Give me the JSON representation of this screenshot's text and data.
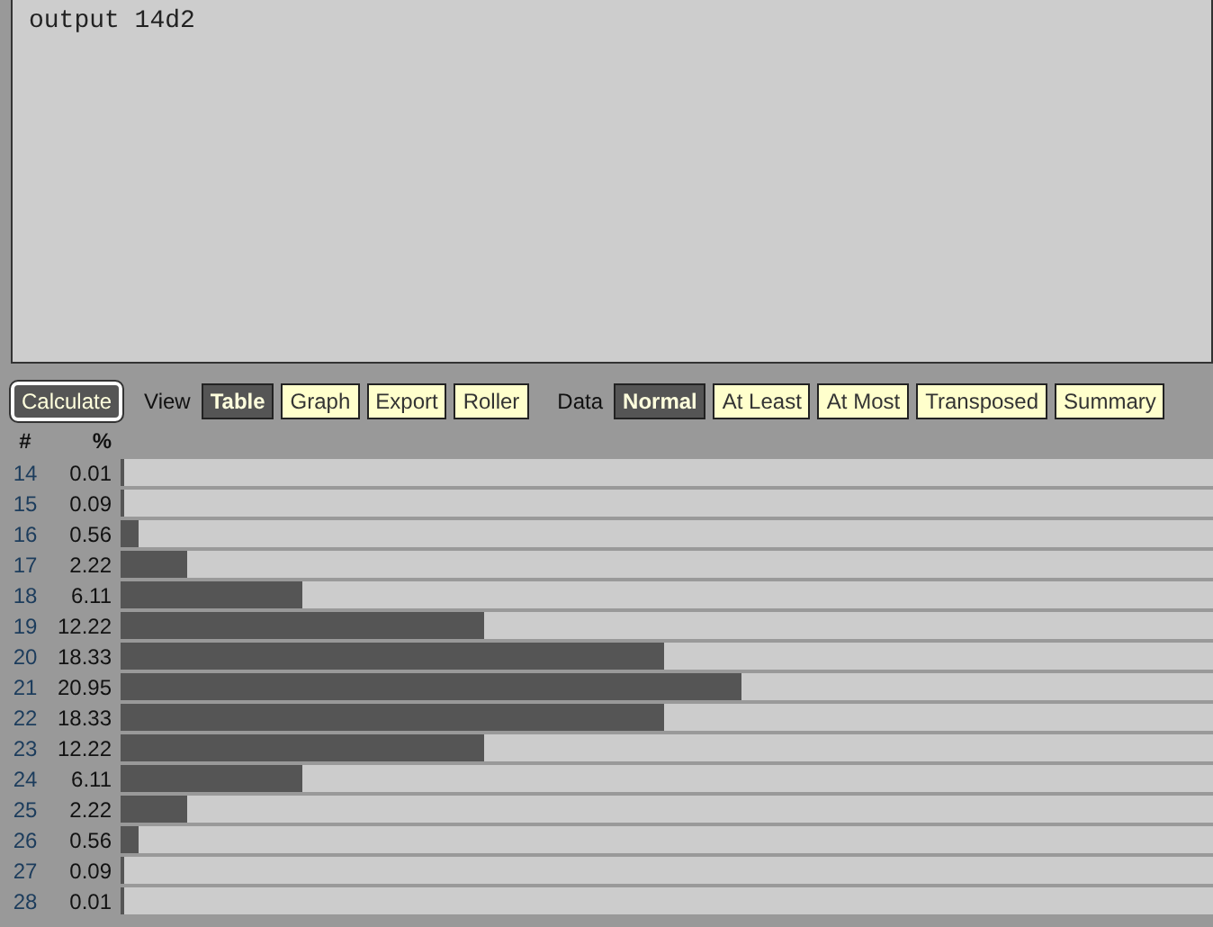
{
  "editor": {
    "value": "output 14d2"
  },
  "toolbar": {
    "calculate": "Calculate",
    "view_label": "View",
    "view_buttons": [
      {
        "label": "Table",
        "selected": true
      },
      {
        "label": "Graph",
        "selected": false
      },
      {
        "label": "Export",
        "selected": false
      },
      {
        "label": "Roller",
        "selected": false
      }
    ],
    "data_label": "Data",
    "data_buttons": [
      {
        "label": "Normal",
        "selected": true
      },
      {
        "label": "At Least",
        "selected": false
      },
      {
        "label": "At Most",
        "selected": false
      },
      {
        "label": "Transposed",
        "selected": false
      },
      {
        "label": "Summary",
        "selected": false
      }
    ]
  },
  "table": {
    "columns": [
      "#",
      "%"
    ],
    "rows": [
      {
        "value": "14",
        "percent": "0.01",
        "level": 0.0003
      },
      {
        "value": "15",
        "percent": "0.09",
        "level": 0.0024
      },
      {
        "value": "16",
        "percent": "0.56",
        "level": 0.0152
      },
      {
        "value": "17",
        "percent": "2.22",
        "level": 0.0602
      },
      {
        "value": "18",
        "percent": "6.11",
        "level": 0.1656
      },
      {
        "value": "19",
        "percent": "12.22",
        "level": 0.3311
      },
      {
        "value": "20",
        "percent": "18.33",
        "level": 0.4967
      },
      {
        "value": "21",
        "percent": "20.95",
        "level": 0.5677
      },
      {
        "value": "22",
        "percent": "18.33",
        "level": 0.4967
      },
      {
        "value": "23",
        "percent": "12.22",
        "level": 0.3311
      },
      {
        "value": "24",
        "percent": "6.11",
        "level": 0.1656
      },
      {
        "value": "25",
        "percent": "2.22",
        "level": 0.0602
      },
      {
        "value": "26",
        "percent": "0.56",
        "level": 0.0152
      },
      {
        "value": "27",
        "percent": "0.09",
        "level": 0.0024
      },
      {
        "value": "28",
        "percent": "0.01",
        "level": 0.0003
      }
    ]
  }
}
